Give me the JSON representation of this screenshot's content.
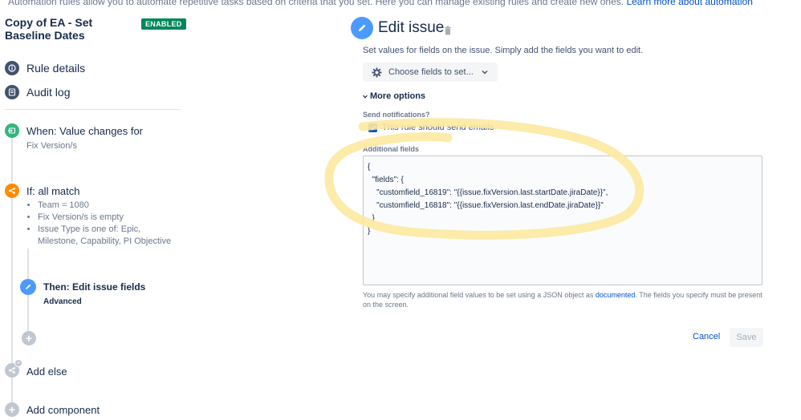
{
  "top_banner": {
    "text": "Automation rules allow you to automate repetitive tasks based on criteria that you set. Here you can manage existing rules and create new ones.",
    "link": "Learn more about automation"
  },
  "rule": {
    "title": "Copy of EA - Set Baseline Dates",
    "status": "ENABLED"
  },
  "nav": {
    "rule_details": "Rule details",
    "audit_log": "Audit log"
  },
  "trigger": {
    "title": "When: Value changes for",
    "sub": "Fix Version/s",
    "color": "#36b37e"
  },
  "condition": {
    "title": "If: all match",
    "items": [
      "Team = 1080",
      "Fix Version/s is empty",
      "Issue Type is one of: Epic, Milestone, Capability, PI Objective"
    ],
    "color": "#ff8b00"
  },
  "action": {
    "title": "Then: Edit issue fields",
    "sub": "Advanced",
    "color": "#4c9aff"
  },
  "add_else": "Add else",
  "add_component": "Add component",
  "panel": {
    "title": "Edit issue",
    "description": "Set values for fields on the issue. Simply add the fields you want to edit.",
    "choose_fields": "Choose fields to set...",
    "more_options": "More options",
    "send_notifications_label": "Send notifications?",
    "send_emails_label": "This rule should send emails",
    "send_emails_checked": true,
    "additional_fields_label": "Additional fields",
    "additional_fields_value": "{\n  \"fields\": {\n    \"customfield_16819\": \"{{issue.fixVersion.last.startDate.jiraDate}}\",\n    \"customfield_16818\": \"{{issue.fixVersion.last.endDate.jiraDate}}\"\n  }\n}",
    "help_before": "You may specify additional field values to be set using a JSON object as ",
    "help_link": "documented",
    "help_after": ". The fields you specify must be present on the screen.",
    "cancel": "Cancel",
    "save": "Save"
  },
  "annotation_color": "#fce9a0"
}
